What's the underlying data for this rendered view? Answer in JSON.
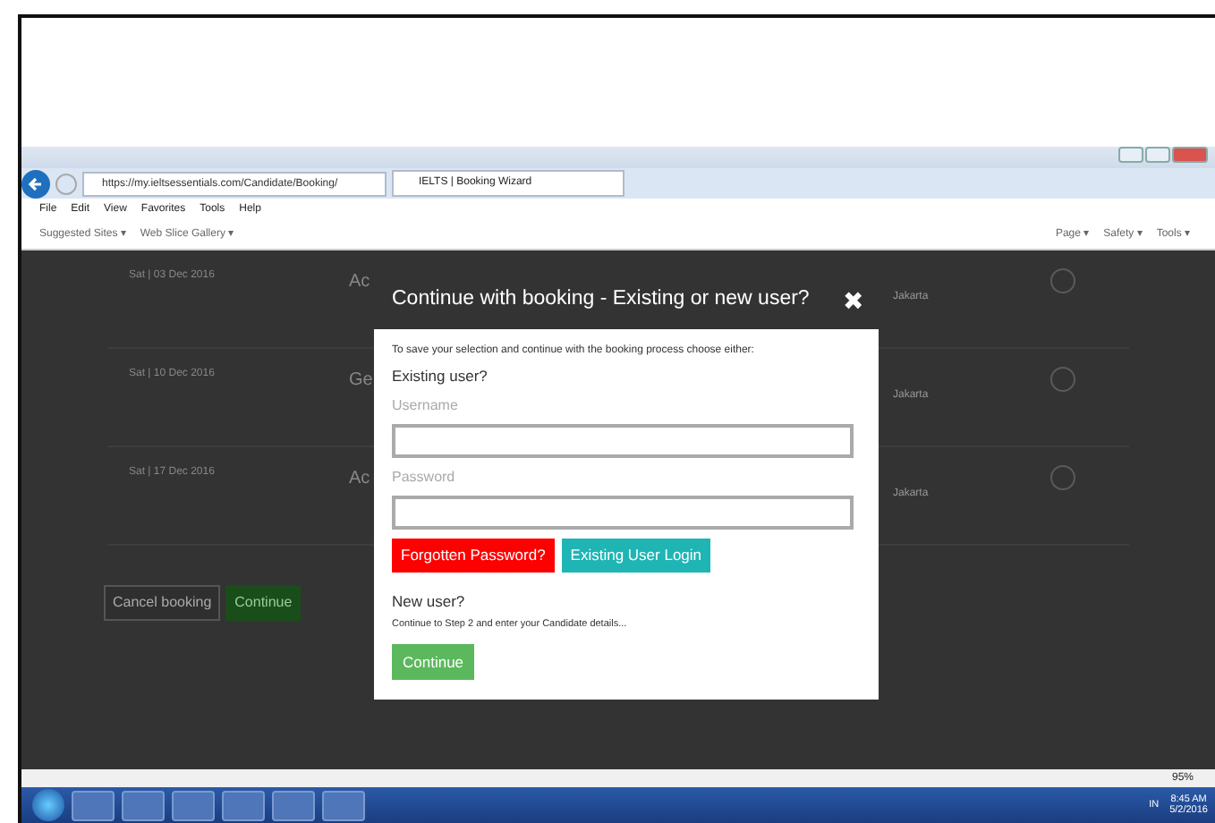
{
  "browser": {
    "url": "https://my.ieltsessentials.com/Candidate/Booking/",
    "tab_title": "IELTS | Booking Wizard",
    "menu": [
      "File",
      "Edit",
      "View",
      "Favorites",
      "Tools",
      "Help"
    ],
    "favorites": [
      "Suggested Sites ▾",
      "Web Slice Gallery ▾"
    ],
    "command_bar": [
      "Page ▾",
      "Safety ▾",
      "Tools ▾"
    ]
  },
  "page": {
    "bookings": [
      {
        "date": "Sat | 03 Dec 2016",
        "column_2": "Ac",
        "location": "Jakarta",
        "selected": false
      },
      {
        "date": "Sat | 10 Dec 2016",
        "column_2": "Ge",
        "location": "Jakarta",
        "selected": false
      },
      {
        "date": "Sat | 17 Dec 2016",
        "column_2": "Ac",
        "location": "Jakarta",
        "selected": false
      }
    ],
    "buttons": [
      {
        "label": "Cancel booking",
        "kind": "outline"
      },
      {
        "label": "Continue",
        "kind": "success"
      }
    ]
  },
  "modal": {
    "title": "Continue with booking - Existing or new user?",
    "close": "✖",
    "intro": "To save your selection and continue with the booking process choose either:",
    "existing_heading": "Existing user?",
    "fields": [
      {
        "label": "Username"
      },
      {
        "label": "Password"
      }
    ],
    "buttons": [
      {
        "label": "Forgotten Password?",
        "kind": "danger"
      },
      {
        "label": "Existing User Login",
        "kind": "info"
      }
    ],
    "new_heading": "New user?",
    "new_text": "Continue to Step 2 and enter your Candidate details...",
    "continue": "Continue"
  },
  "status_bar": {
    "zoom": "95%"
  },
  "taskbar": {
    "language": "IN",
    "time": "8:45 AM",
    "date": "5/2/2016"
  }
}
